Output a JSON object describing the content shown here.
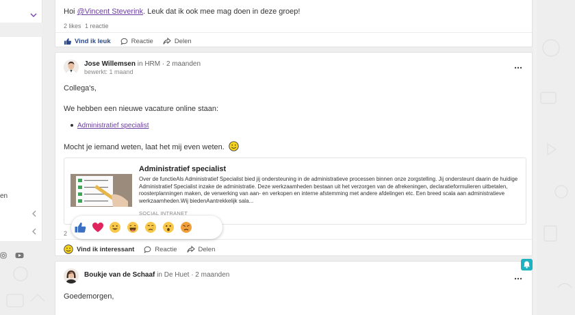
{
  "sidebar": {
    "partial_label": "en"
  },
  "post1": {
    "text_prefix": "Hoi ",
    "mention": "@Vincent Steverink",
    "text_suffix": ". Leuk dat ik ook mee mag doen in deze groep!",
    "likes": "2 likes",
    "reactions": "1 reactie",
    "actions": {
      "like": "Vind ik leuk",
      "comment": "Reactie",
      "share": "Delen"
    }
  },
  "post2": {
    "author": "Jose Willemsen",
    "in_word": "in",
    "group": "HRM",
    "time": "· 2 maanden",
    "edited": "bewerkt: 1 maand",
    "greeting": "Collega's,",
    "line1": "We hebben een nieuwe vacature online staan:",
    "bullet_link": "Administratief specialist",
    "line2": "Mocht je iemand weten, laat het mij even weten.",
    "preview": {
      "title": "Administratief specialist",
      "description": "Over de functieAls Administratief Specialist bied jij ondersteuning in de administratieve processen binnen onze zorgstelling. Jij ondersteunt daarin de huidige Administratief Specialist inzake de administratie. Deze werkzaamheden bestaan uit het verzorgen van de afrekeningen, declaratieformulieren uitbetalen, roosterplanningen maken, de verwerking van aan- en verkopen en interne afstemming met andere afdelingen etc. Een breed scala aan administratieve werkzaamheden.Wij biedenAantrekkelijk sala...",
      "source": "SOCIAL INTRANET"
    },
    "stats_partial": "2",
    "actions": {
      "like": "Vind ik interessant",
      "comment": "Reactie",
      "share": "Delen"
    },
    "reaction_names": [
      "thumbs-up",
      "heart",
      "smile",
      "laugh",
      "sad",
      "surprised",
      "angry"
    ]
  },
  "post3": {
    "author": "Boukje van de Schaaf",
    "in_word": "in",
    "group": "De Huet",
    "time": "· 2 maanden",
    "greeting": "Goedemorgen,"
  },
  "colors": {
    "accent_blue": "#2c4a8c",
    "link_purple": "#6b3fa0",
    "notify_teal": "#1fb2c1",
    "heart_red": "#e0245e"
  }
}
